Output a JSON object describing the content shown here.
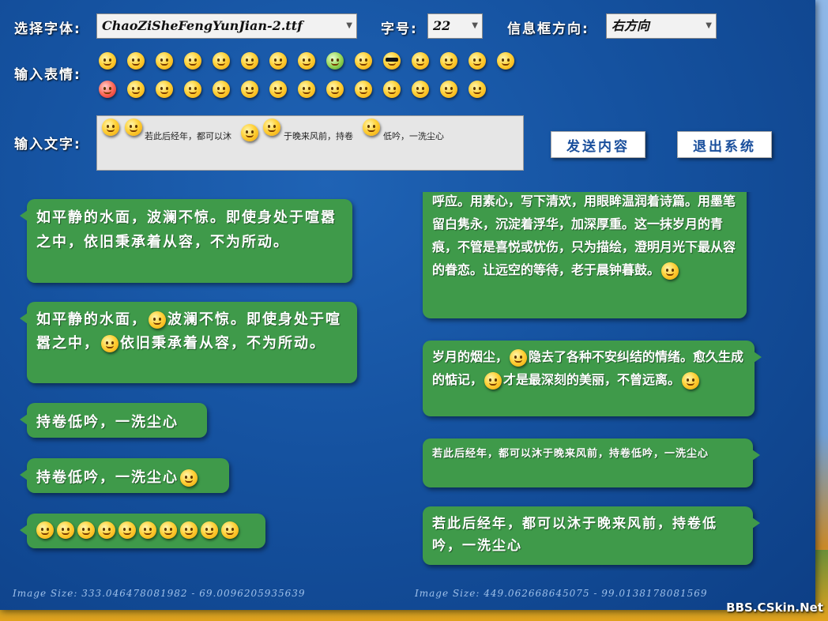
{
  "labels": {
    "font_select": "选择字体:",
    "font_size": "字号:",
    "direction": "信息框方向:",
    "emotion": "输入表情:",
    "text_input": "输入文字:"
  },
  "controls": {
    "font_value": "ChaoZiSheFengYunJian-2.ttf",
    "size_value": "22",
    "direction_value": "右方向"
  },
  "emotions": [
    "happy-tongue",
    "smile",
    "laugh-tears",
    "crying",
    "awkward",
    "surprised",
    "shy-cover",
    "blush",
    "sick-green",
    "grin",
    "cool-sunglasses",
    "kiss",
    "wink",
    "sob",
    "big-grin",
    "angry",
    "smile-2",
    "smile-3",
    "sweat",
    "dizzy",
    "hand-cover",
    "grin-2",
    "tongue",
    "happy",
    "hug",
    "smirk",
    "snicker",
    "cold-sweat",
    "laugh"
  ],
  "input": {
    "part1": "若此后经年，都可以沐",
    "part2": "于晚来风前，持卷",
    "part3": "低吟，一洗尘心"
  },
  "buttons": {
    "send": "发送内容",
    "exit": "退出系统"
  },
  "left_messages": [
    "如平静的水面，波澜不惊。即使身处于喧嚣之中，依旧秉承着从容，不为所动。",
    [
      "如平静的水面，",
      "波澜不惊。即使身处于喧嚣之中，",
      "依旧秉承着从容，不为所动。"
    ],
    "持卷低吟，一洗尘心",
    "持卷低吟，一洗尘心"
  ],
  "right_messages": [
    "涟漪。听凭岁月缓步而来，在流年的风韵里，和风遥相呼应。用素心，写下清欢，用眼眸温润着诗篇。用墨笔留白隽永，沉淀着浮华，加深厚重。这一抹岁月的青痕，不管是喜悦或忧伤，只为描绘，澄明月光下最从容的眷恋。让远空的等待，老于晨钟暮鼓。",
    [
      "岁月的烟尘，",
      "隐去了各种不安纠结的情绪。愈久生成的惦记，",
      "才是最深刻的美丽，不曾远离。"
    ],
    "若此后经年，都可以沐于晚来风前，持卷低吟，一洗尘心",
    "若此后经年，都可以沐于晚来风前，持卷低吟，一洗尘心"
  ],
  "size_labels": {
    "left": "Image Size: 333.046478081982 - 69.0096205935639",
    "right": "Image Size: 449.062668645075 - 99.0138178081569"
  },
  "watermark": "BBS.CSkin.Net"
}
